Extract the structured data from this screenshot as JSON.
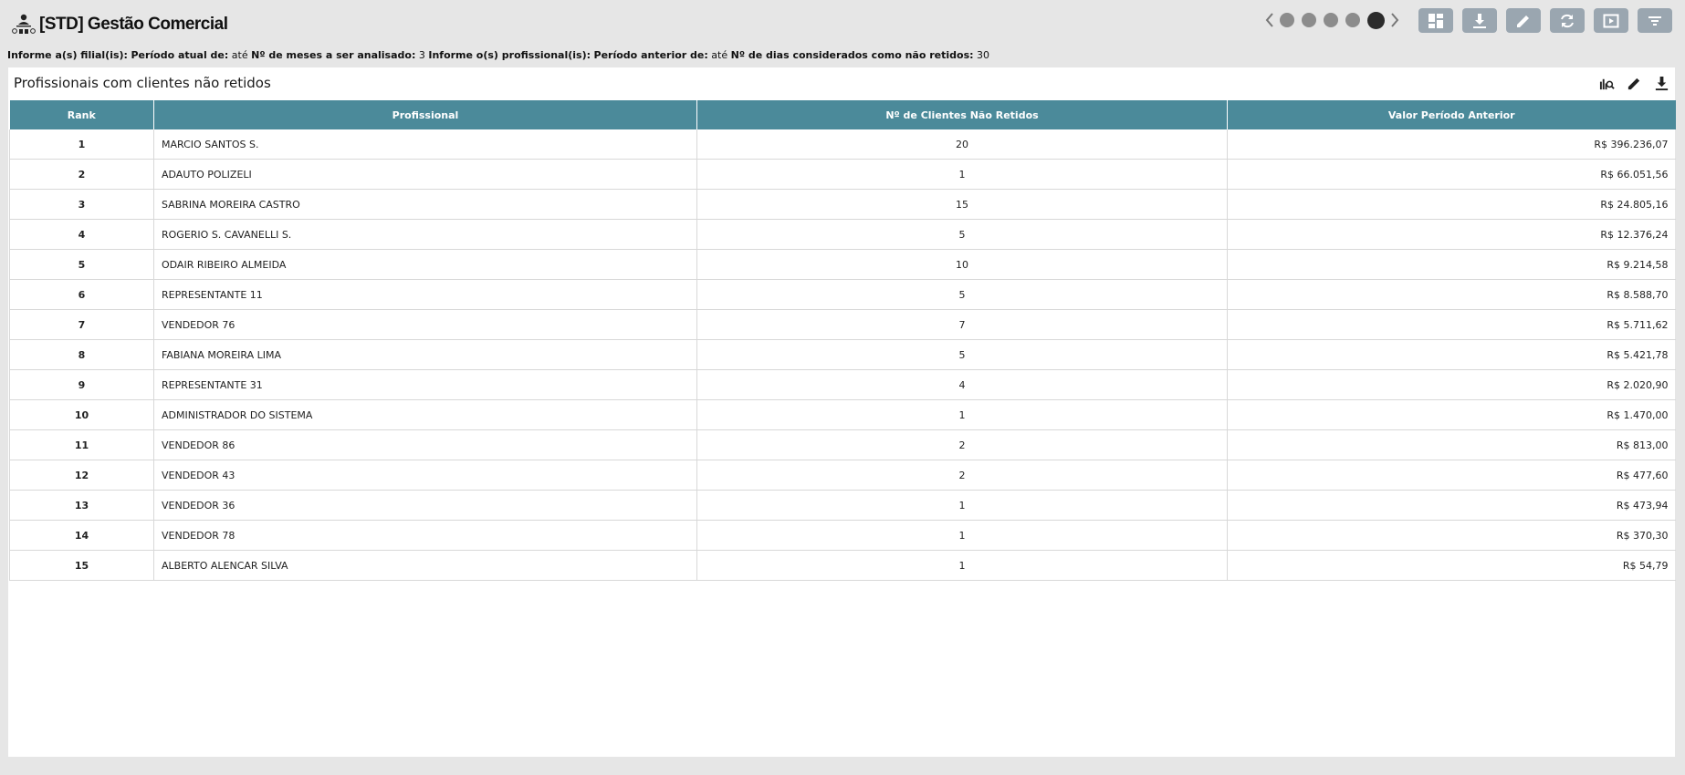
{
  "header": {
    "title": "[STD] Gestão Comercial",
    "app_icon": "sales-team-icon",
    "pager": {
      "dots": 5,
      "active_index": 5
    },
    "toolbar": [
      "dashboard-icon",
      "download-icon",
      "edit-icon",
      "refresh-icon",
      "presentation-icon",
      "filter-icon"
    ]
  },
  "filters": [
    {
      "label": "Informe a(s) filial(is):",
      "value": ""
    },
    {
      "label": "Período atual de:",
      "value": "até"
    },
    {
      "label": "Nº de meses a ser analisado:",
      "value": "3"
    },
    {
      "label": "Informe o(s) profissional(is):",
      "value": ""
    },
    {
      "label": "Período anterior de:",
      "value": "até"
    },
    {
      "label": "Nº de dias considerados como não retidos:",
      "value": "30"
    }
  ],
  "panel": {
    "title": "Profissionais com clientes não retidos",
    "tools": [
      "analytics-icon",
      "edit-icon",
      "download-icon"
    ]
  },
  "table": {
    "columns": [
      "Rank",
      "Profissional",
      "Nº de Clientes Não Retidos",
      "Valor Período Anterior"
    ],
    "rows": [
      [
        "1",
        "MARCIO SANTOS S.",
        "20",
        "R$ 396.236,07"
      ],
      [
        "2",
        "ADAUTO POLIZELI",
        "1",
        "R$ 66.051,56"
      ],
      [
        "3",
        "SABRINA MOREIRA CASTRO",
        "15",
        "R$ 24.805,16"
      ],
      [
        "4",
        "ROGERIO S. CAVANELLI S.",
        "5",
        "R$ 12.376,24"
      ],
      [
        "5",
        "ODAIR RIBEIRO ALMEIDA",
        "10",
        "R$ 9.214,58"
      ],
      [
        "6",
        "REPRESENTANTE 11",
        "5",
        "R$ 8.588,70"
      ],
      [
        "7",
        "VENDEDOR 76",
        "7",
        "R$ 5.711,62"
      ],
      [
        "8",
        "FABIANA MOREIRA LIMA",
        "5",
        "R$ 5.421,78"
      ],
      [
        "9",
        "REPRESENTANTE 31",
        "4",
        "R$ 2.020,90"
      ],
      [
        "10",
        "ADMINISTRADOR DO SISTEMA",
        "1",
        "R$ 1.470,00"
      ],
      [
        "11",
        "VENDEDOR 86",
        "2",
        "R$ 813,00"
      ],
      [
        "12",
        "VENDEDOR 43",
        "2",
        "R$ 477,60"
      ],
      [
        "13",
        "VENDEDOR 36",
        "1",
        "R$ 473,94"
      ],
      [
        "14",
        "VENDEDOR 78",
        "1",
        "R$ 370,30"
      ],
      [
        "15",
        "ALBERTO ALENCAR SILVA",
        "1",
        "R$ 54,79"
      ]
    ]
  },
  "colors": {
    "header_bg": "#4b8a9a",
    "toolbar_btn": "#9aa6b0",
    "page_bg": "#e6e6e6"
  }
}
